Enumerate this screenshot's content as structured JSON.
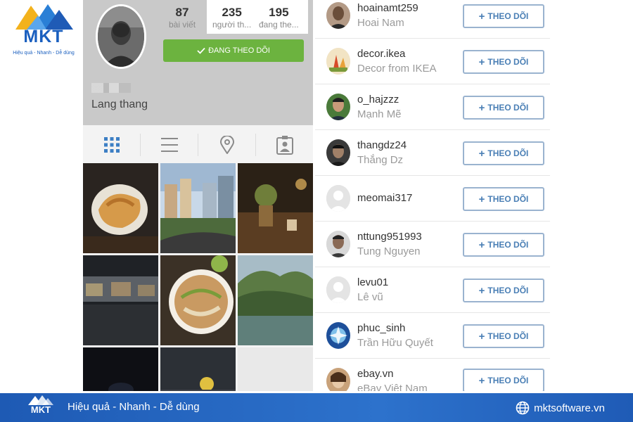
{
  "brand": {
    "logo_text": "MKT",
    "logo_slogan": "Hiệu quả - Nhanh - Dễ dùng"
  },
  "profile": {
    "stats": [
      {
        "value": "87",
        "label": "bài viết"
      },
      {
        "value": "235",
        "label": "người th..."
      },
      {
        "value": "195",
        "label": "đang the..."
      }
    ],
    "following_button": "ĐANG THEO DÕI",
    "bio": "Lang thang",
    "tabs": [
      "grid-icon",
      "list-icon",
      "location-pin-icon",
      "tagged-user-icon"
    ]
  },
  "follow_list": {
    "button_label": "THEO DÕI",
    "users": [
      {
        "username": "hoainamt259",
        "name": "Hoai Nam"
      },
      {
        "username": "decor.ikea",
        "name": "Decor from IKEA"
      },
      {
        "username": "o_hajzzz",
        "name": "Mạnh Mẽ"
      },
      {
        "username": "thangdz24",
        "name": "Thắng Dz"
      },
      {
        "username": "meomai317",
        "name": ""
      },
      {
        "username": "nttung951993",
        "name": "Tung Nguyen"
      },
      {
        "username": "levu01",
        "name": "Lê vũ"
      },
      {
        "username": "phuc_sinh",
        "name": "Trần Hữu Quyết"
      },
      {
        "username": "ebay.vn",
        "name": "eBay Việt Nam"
      }
    ]
  },
  "banner": {
    "slogan": "Hiệu quả - Nhanh - Dễ dùng",
    "website": "mktsoftware.vn"
  },
  "colors": {
    "brand_blue": "#1e5ab4",
    "following_green": "#6cb33f",
    "follow_button_text": "#4a7fb5",
    "follow_button_border": "#9ab3cf"
  }
}
